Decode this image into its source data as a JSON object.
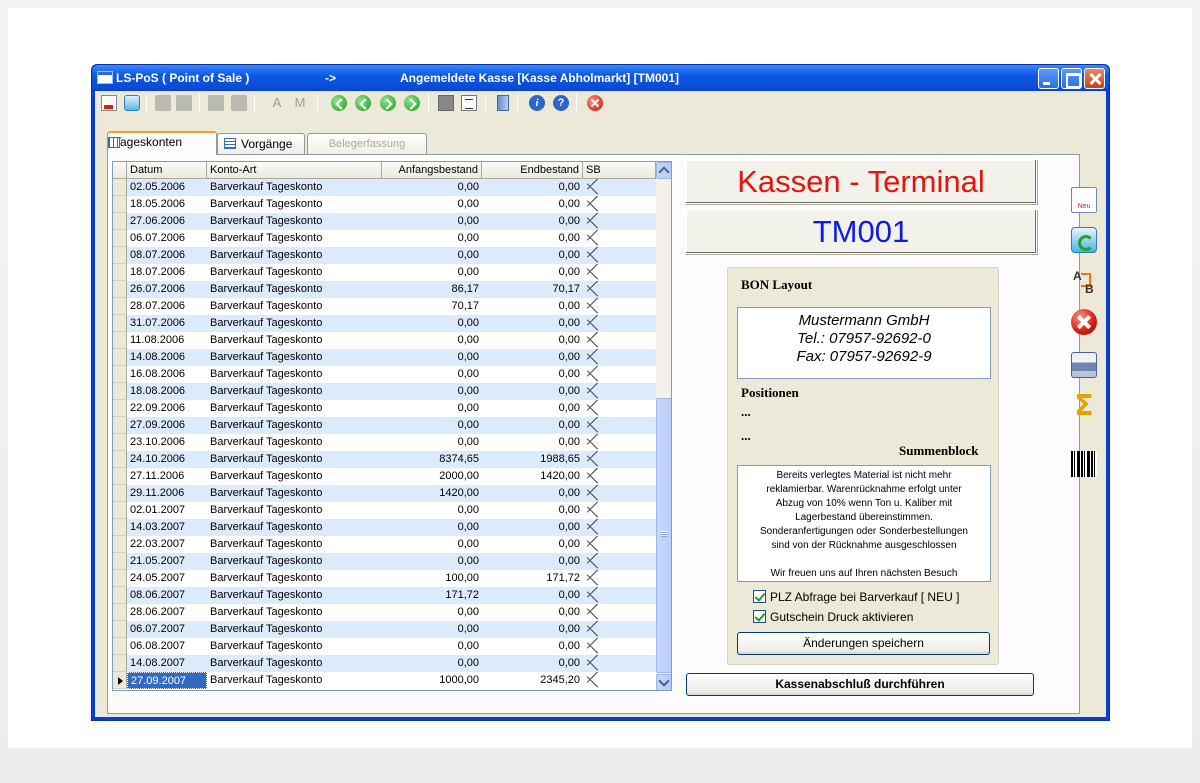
{
  "window": {
    "title_app": "LS-PoS ( Point of Sale )",
    "title_arrow": "->",
    "title_context": "Angemeldete Kasse [Kasse Abholmarkt] [TM001]"
  },
  "toolbar": {
    "letter_a": "A",
    "letter_m": "M",
    "info": "i",
    "help": "?"
  },
  "tabs": [
    {
      "label": "Tageskonten"
    },
    {
      "label": "Vorgänge"
    },
    {
      "label": "Belegerfassung"
    }
  ],
  "grid": {
    "columns": [
      "Datum",
      "Konto-Art",
      "Anfangsbestand",
      "Endbestand",
      "SB"
    ],
    "rows": [
      {
        "date": "02.05.2006",
        "konto": "Barverkauf Tageskonto",
        "anfang": "0,00",
        "end": "0,00"
      },
      {
        "date": "18.05.2006",
        "konto": "Barverkauf Tageskonto",
        "anfang": "0,00",
        "end": "0,00"
      },
      {
        "date": "27.06.2006",
        "konto": "Barverkauf Tageskonto",
        "anfang": "0,00",
        "end": "0,00"
      },
      {
        "date": "06.07.2006",
        "konto": "Barverkauf Tageskonto",
        "anfang": "0,00",
        "end": "0,00"
      },
      {
        "date": "08.07.2006",
        "konto": "Barverkauf Tageskonto",
        "anfang": "0,00",
        "end": "0,00"
      },
      {
        "date": "18.07.2006",
        "konto": "Barverkauf Tageskonto",
        "anfang": "0,00",
        "end": "0,00"
      },
      {
        "date": "26.07.2006",
        "konto": "Barverkauf Tageskonto",
        "anfang": "86,17",
        "end": "70,17"
      },
      {
        "date": "28.07.2006",
        "konto": "Barverkauf Tageskonto",
        "anfang": "70,17",
        "end": "0,00"
      },
      {
        "date": "31.07.2006",
        "konto": "Barverkauf Tageskonto",
        "anfang": "0,00",
        "end": "0,00"
      },
      {
        "date": "11.08.2006",
        "konto": "Barverkauf Tageskonto",
        "anfang": "0,00",
        "end": "0,00"
      },
      {
        "date": "14.08.2006",
        "konto": "Barverkauf Tageskonto",
        "anfang": "0,00",
        "end": "0,00"
      },
      {
        "date": "16.08.2006",
        "konto": "Barverkauf Tageskonto",
        "anfang": "0,00",
        "end": "0,00"
      },
      {
        "date": "18.08.2006",
        "konto": "Barverkauf Tageskonto",
        "anfang": "0,00",
        "end": "0,00"
      },
      {
        "date": "22.09.2006",
        "konto": "Barverkauf Tageskonto",
        "anfang": "0,00",
        "end": "0,00"
      },
      {
        "date": "27.09.2006",
        "konto": "Barverkauf Tageskonto",
        "anfang": "0,00",
        "end": "0,00"
      },
      {
        "date": "23.10.2006",
        "konto": "Barverkauf Tageskonto",
        "anfang": "0,00",
        "end": "0,00"
      },
      {
        "date": "24.10.2006",
        "konto": "Barverkauf Tageskonto",
        "anfang": "8374,65",
        "end": "1988,65"
      },
      {
        "date": "27.11.2006",
        "konto": "Barverkauf Tageskonto",
        "anfang": "2000,00",
        "end": "1420,00"
      },
      {
        "date": "29.11.2006",
        "konto": "Barverkauf Tageskonto",
        "anfang": "1420,00",
        "end": "0,00"
      },
      {
        "date": "02.01.2007",
        "konto": "Barverkauf Tageskonto",
        "anfang": "0,00",
        "end": "0,00"
      },
      {
        "date": "14.03.2007",
        "konto": "Barverkauf Tageskonto",
        "anfang": "0,00",
        "end": "0,00"
      },
      {
        "date": "22.03.2007",
        "konto": "Barverkauf Tageskonto",
        "anfang": "0,00",
        "end": "0,00"
      },
      {
        "date": "21.05.2007",
        "konto": "Barverkauf Tageskonto",
        "anfang": "0,00",
        "end": "0,00"
      },
      {
        "date": "24.05.2007",
        "konto": "Barverkauf Tageskonto",
        "anfang": "100,00",
        "end": "171,72"
      },
      {
        "date": "08.06.2007",
        "konto": "Barverkauf Tageskonto",
        "anfang": "171,72",
        "end": "0,00"
      },
      {
        "date": "28.06.2007",
        "konto": "Barverkauf Tageskonto",
        "anfang": "0,00",
        "end": "0,00"
      },
      {
        "date": "06.07.2007",
        "konto": "Barverkauf Tageskonto",
        "anfang": "0,00",
        "end": "0,00"
      },
      {
        "date": "06.08.2007",
        "konto": "Barverkauf Tageskonto",
        "anfang": "0,00",
        "end": "0,00"
      },
      {
        "date": "14.08.2007",
        "konto": "Barverkauf Tageskonto",
        "anfang": "0,00",
        "end": "0,00"
      },
      {
        "date": "27.09.2007",
        "konto": "Barverkauf Tageskonto",
        "anfang": "1000,00",
        "end": "2345,20",
        "current": true
      }
    ]
  },
  "terminal": {
    "heading": "Kassen - Terminal",
    "id": "TM001",
    "heading_color": "#e2150f",
    "id_color": "#0d1be8"
  },
  "bon": {
    "label": "BON Layout",
    "company_line1": "Mustermann GmbH",
    "company_line2": "Tel.: 07957-92692-0",
    "company_line3": "Fax: 07957-92692-9",
    "positions_label": "Positionen",
    "dots1": "...",
    "dots2": "...",
    "sum_label": "Summenblock",
    "notice_line1": "Bereits verlegtes Material ist nicht mehr",
    "notice_line2": "reklamierbar. Warenrücknahme erfolgt unter",
    "notice_line3": "Abzug von 10% wenn Ton u. Kaliber mit",
    "notice_line4": "Lagerbestand übereinstimmen.",
    "notice_line5": "Sonderanfertigungen oder Sonderbestellungen",
    "notice_line6": "sind von der Rücknahme ausgeschlossen",
    "notice_line7": "Wir freuen uns auf Ihren nächsten Besuch",
    "check_plz": "PLZ Abfrage bei Barverkauf [ NEU ]",
    "check_plz_checked": true,
    "check_gutschein": "Gutschein Druck aktivieren",
    "check_gutschein_checked": true,
    "save_button": "Änderungen speichern"
  },
  "close_day_button": "Kassenabschluß durchführen",
  "sidebar": {
    "new_label": "Neu"
  }
}
